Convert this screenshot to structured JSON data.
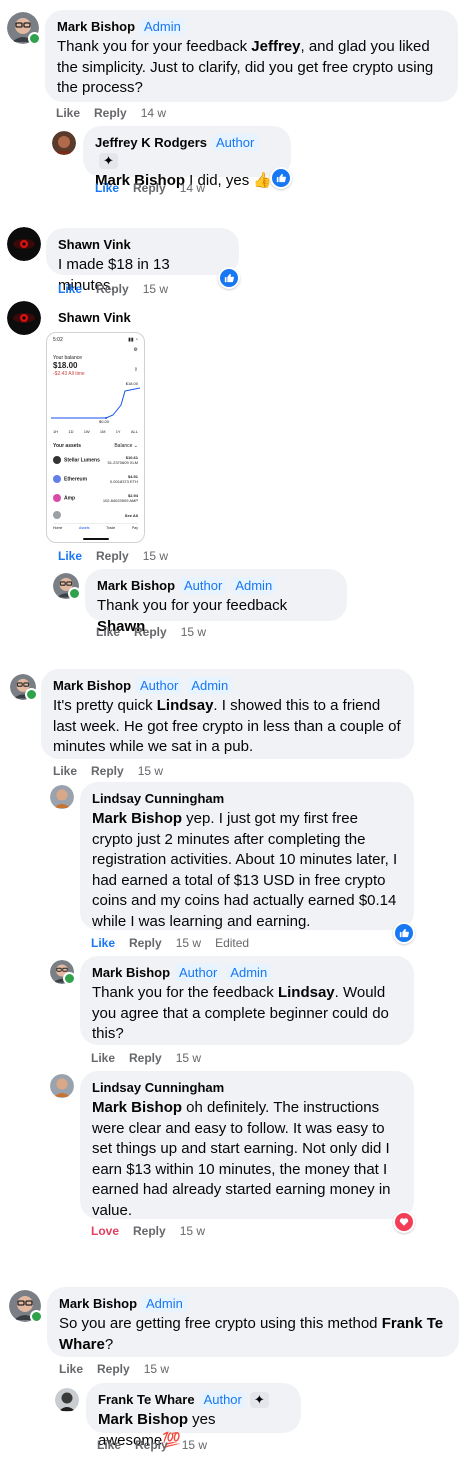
{
  "comments": {
    "c1": {
      "author": "Mark Bishop",
      "badges": [
        "Admin"
      ],
      "text_parts": [
        "Thank you for your feedback ",
        "Jeffrey",
        ", and glad you liked the simplicity. Just to clarify, did you get free crypto using the process?"
      ],
      "like": "Like",
      "reply": "Reply",
      "time": "14 w"
    },
    "c1r1": {
      "author": "Jeffrey K Rodgers",
      "badges": [
        "Author"
      ],
      "mention": "Mark Bishop",
      "text": " I did, yes 👍",
      "like": "Like",
      "reply": "Reply",
      "time": "14 w",
      "reaction": "like"
    },
    "c2": {
      "author": "Shawn Vink",
      "text": "I made $18 in 13 minutes.",
      "like": "Like",
      "reply": "Reply",
      "time": "15 w",
      "reaction": "like"
    },
    "c3": {
      "author": "Shawn Vink",
      "like": "Like",
      "reply": "Reply",
      "time": "15 w",
      "phone": {
        "status_time": "5:02",
        "balance_label": "Your balance",
        "balance": "$18.00",
        "change": "-$2.43 All time",
        "chart_max": "$18.00",
        "chart_min": "$0.00",
        "ranges": [
          "1H",
          "1D",
          "1W",
          "1M",
          "1Y",
          "ALL"
        ],
        "assets_label": "Your assets",
        "sort_label": "Balance ⌄",
        "assets": [
          {
            "name": "Stellar Lumens",
            "usd": "$10.61",
            "amount": "51.2370609 XLM",
            "color": "#333333"
          },
          {
            "name": "Ethereum",
            "usd": "$4.51",
            "amount": "0.0018373 ETH",
            "color": "#627eea"
          },
          {
            "name": "Amp",
            "usd": "$2.94",
            "amount": "102.84023909 AMP",
            "color": "#d94ba8"
          },
          {
            "name": "",
            "usd": "See All",
            "amount": "",
            "color": "#9aa0a6"
          }
        ],
        "nav": [
          "Home",
          "Assets",
          "Trade",
          "Pay"
        ]
      }
    },
    "c3r1": {
      "author": "Mark Bishop",
      "badges": [
        "Author",
        "Admin"
      ],
      "text_parts": [
        "Thank you for your feedback ",
        "Shawn",
        ""
      ],
      "like": "Like",
      "reply": "Reply",
      "time": "15 w"
    },
    "c4": {
      "author": "Mark Bishop",
      "badges": [
        "Author",
        "Admin"
      ],
      "text_parts": [
        "It's pretty quick ",
        "Lindsay",
        ". I showed this to a friend last week. He got free crypto in less than a couple of minutes while we sat in a pub."
      ],
      "like": "Like",
      "reply": "Reply",
      "time": "15 w"
    },
    "c4r1": {
      "author": "Lindsay Cunningham",
      "mention": "Mark Bishop",
      "text": " yep. I just got my first free crypto just 2 minutes after completing the registration activities. About 10 minutes later, I had earned a total of $13 USD in free crypto coins and my coins had actually earned $0.14 while I was learning and earning.",
      "like": "Like",
      "reply": "Reply",
      "time": "15 w",
      "edited": "Edited",
      "reaction": "like"
    },
    "c4r2": {
      "author": "Mark Bishop",
      "badges": [
        "Author",
        "Admin"
      ],
      "text_parts": [
        "Thank you for the feedback ",
        "Lindsay",
        ". Would you agree that a complete beginner could do this?"
      ],
      "like": "Like",
      "reply": "Reply",
      "time": "15 w"
    },
    "c4r3": {
      "author": "Lindsay Cunningham",
      "mention": "Mark Bishop",
      "text": " oh definitely. The instructions were clear and easy to follow. It was easy to set things up and start earning. Not only did I earn $13 within 10 minutes, the money that I earned had already started earning money in value.",
      "like": "Love",
      "reply": "Reply",
      "time": "15 w",
      "reaction": "love"
    },
    "c5": {
      "author": "Mark Bishop",
      "badges": [
        "Admin"
      ],
      "text_parts": [
        "So you are getting free crypto using this method ",
        "Frank Te Whare",
        "?"
      ],
      "like": "Like",
      "reply": "Reply",
      "time": "15 w"
    },
    "c5r1": {
      "author": "Frank Te Whare",
      "badges": [
        "Author"
      ],
      "mention": "Mark Bishop",
      "text": " yes awesome💯",
      "like": "Like",
      "reply": "Reply",
      "time": "15 w"
    }
  },
  "colors": {
    "accent": "#1877f2",
    "bubble": "#f0f2f5",
    "muted": "#65676b",
    "love": "#e4405f",
    "online": "#31a24c"
  }
}
